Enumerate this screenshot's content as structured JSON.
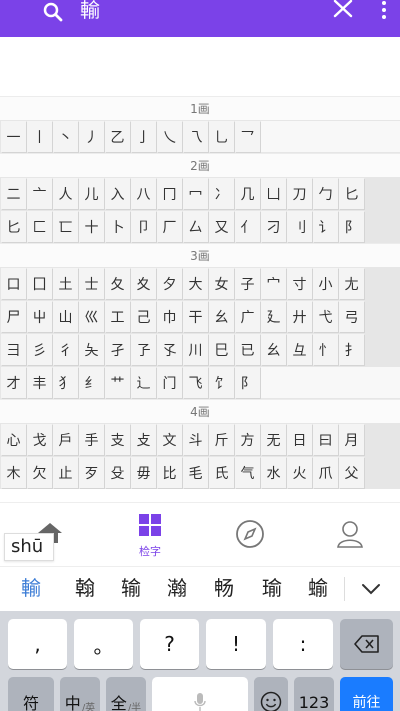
{
  "topbar": {
    "query": "輸",
    "search_icon": "search-icon",
    "close_icon": "close-icon",
    "more_icon": "more-vertical-icon",
    "color": "#7b42e8"
  },
  "sections": [
    {
      "header": "1画",
      "rows": [
        [
          "一",
          "丨",
          "丶",
          "丿",
          "乙",
          "亅",
          "乀",
          "乁",
          "乚",
          "乛"
        ]
      ]
    },
    {
      "header": "2画",
      "rows": [
        [
          "二",
          "亠",
          "人",
          "儿",
          "入",
          "八",
          "冂",
          "冖",
          "冫",
          "几",
          "凵",
          "刀",
          "勹",
          "匕"
        ],
        [
          "匕",
          "匚",
          "匸",
          "十",
          "卜",
          "卩",
          "厂",
          "厶",
          "又",
          "亻",
          "刁",
          "刂",
          "讠",
          "阝"
        ]
      ]
    },
    {
      "header": "3画",
      "rows": [
        [
          "口",
          "囗",
          "土",
          "士",
          "夂",
          "夊",
          "夕",
          "大",
          "女",
          "子",
          "宀",
          "寸",
          "小",
          "尢"
        ],
        [
          "尸",
          "屮",
          "山",
          "巛",
          "工",
          "己",
          "巾",
          "干",
          "幺",
          "广",
          "廴",
          "廾",
          "弋",
          "弓"
        ],
        [
          "彐",
          "彡",
          "彳",
          "夨",
          "孑",
          "孒",
          "孓",
          "川",
          "巳",
          "已",
          "幺",
          "彑",
          "忄",
          "扌"
        ],
        [
          "才",
          "丰",
          "犭",
          "纟",
          "艹",
          "辶",
          "门",
          "飞",
          "饣",
          "阝"
        ]
      ]
    },
    {
      "header": "4画",
      "rows": [
        [
          "心",
          "戈",
          "戶",
          "手",
          "支",
          "攴",
          "文",
          "斗",
          "斤",
          "方",
          "无",
          "日",
          "曰",
          "月"
        ],
        [
          "木",
          "欠",
          "止",
          "歹",
          "殳",
          "毋",
          "比",
          "毛",
          "氏",
          "气",
          "水",
          "火",
          "爪",
          "父"
        ]
      ]
    }
  ],
  "bottom_nav": {
    "items": [
      {
        "icon": "home-icon",
        "label": ""
      },
      {
        "icon": "grid-icon",
        "label": "检字"
      },
      {
        "icon": "compass-icon",
        "label": ""
      },
      {
        "icon": "user-icon",
        "label": ""
      }
    ],
    "active_color": "#7b42e8"
  },
  "pinyin": "shū",
  "candidates": [
    "輸",
    "翰",
    "输",
    "瀚",
    "畅",
    "瑜",
    "蝓"
  ],
  "expand_icon": "chevron-down-icon",
  "keyboard": {
    "row1": [
      ",",
      "。",
      "?",
      "!",
      ":"
    ],
    "backspace_icon": "backspace-icon",
    "row2": {
      "symbol": "符",
      "lang_main": "中",
      "lang_sub": "/英",
      "width_main": "全",
      "width_sub": "/半",
      "mic_icon": "microphone-icon",
      "emoji_icon": "emoji-icon",
      "num": "123",
      "enter": "前往"
    }
  }
}
